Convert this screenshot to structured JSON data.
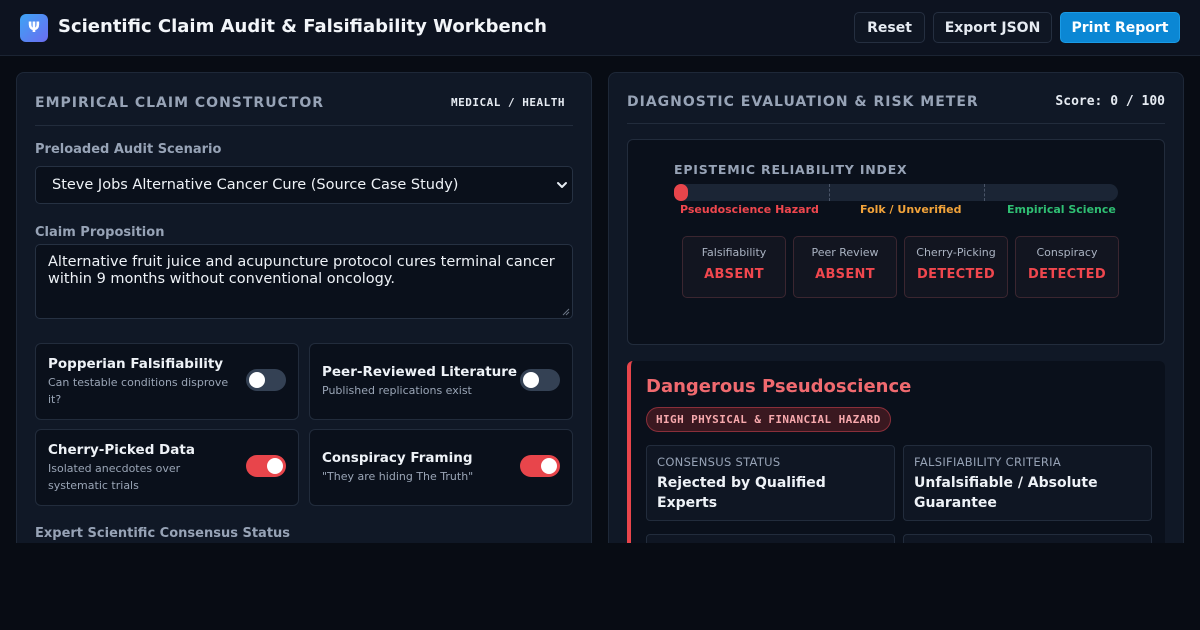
{
  "header": {
    "logo_glyph": "Ψ",
    "title": "Scientific Claim Audit & Falsifiability Workbench",
    "buttons": {
      "reset": "Reset",
      "export": "Export JSON",
      "print": "Print Report"
    }
  },
  "constructor": {
    "title": "EMPIRICAL CLAIM CONSTRUCTOR",
    "domain_tag": "MEDICAL / HEALTH",
    "scenario_label": "Preloaded Audit Scenario",
    "scenario_value": "Steve Jobs Alternative Cancer Cure (Source Case Study)",
    "claim_label": "Claim Proposition",
    "claim_text": "Alternative fruit juice and acupuncture protocol cures terminal cancer within 9 months without conventional oncology.",
    "toggles": [
      {
        "title": "Popperian Falsifiability",
        "desc": "Can testable conditions disprove it?",
        "on": false
      },
      {
        "title": "Peer-Reviewed Literature",
        "desc": "Published replications exist",
        "on": false
      },
      {
        "title": "Cherry-Picked Data",
        "desc": "Isolated anecdotes over systematic trials",
        "on": true
      },
      {
        "title": "Conspiracy Framing",
        "desc": "\"They are hiding The Truth\"",
        "on": true
      }
    ],
    "consensus_label": "Expert Scientific Consensus Status"
  },
  "evaluation": {
    "title": "DIAGNOSTIC EVALUATION & RISK METER",
    "score_text": "Score: 0 / 100",
    "score": 0,
    "meter": {
      "label": "EPISTEMIC RELIABILITY INDEX",
      "zones": [
        {
          "label": "Pseudoscience Hazard",
          "color": "#f0474e"
        },
        {
          "label": "Folk / Unverified",
          "color": "#f2a33a"
        },
        {
          "label": "Empirical Science",
          "color": "#2fbf73"
        }
      ]
    },
    "indicators": [
      {
        "name": "Falsifiability",
        "value": "ABSENT"
      },
      {
        "name": "Peer Review",
        "value": "ABSENT"
      },
      {
        "name": "Cherry-Picking",
        "value": "DETECTED"
      },
      {
        "name": "Conspiracy",
        "value": "DETECTED"
      }
    ],
    "verdict": {
      "title": "Dangerous Pseudoscience",
      "hazard": "HIGH PHYSICAL & FINANCIAL HAZARD",
      "details": [
        {
          "key": "CONSENSUS STATUS",
          "value": "Rejected by Qualified Experts"
        },
        {
          "key": "FALSIFIABILITY CRITERIA",
          "value": "Unfalsifiable / Absolute Guarantee"
        }
      ]
    }
  },
  "colors": {
    "accent": "#0b87d4",
    "danger": "#e8454b",
    "toggle_off": "#344154"
  }
}
